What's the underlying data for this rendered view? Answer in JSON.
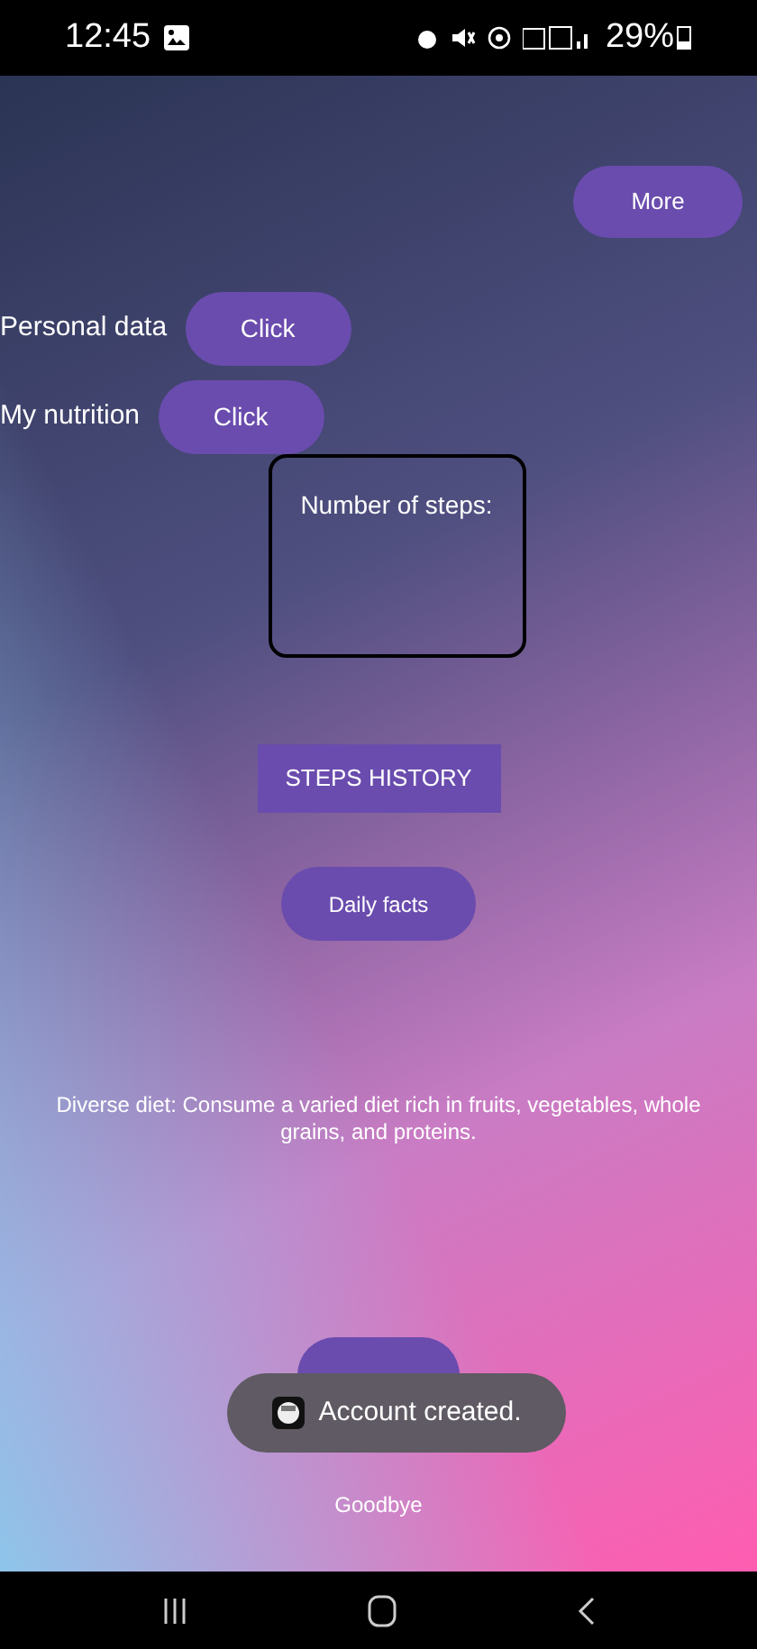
{
  "status_bar": {
    "time": "12:45",
    "battery": "29%"
  },
  "more_button": {
    "label": "More"
  },
  "rows": [
    {
      "label": "Personal data",
      "button": "Click"
    },
    {
      "label": "My nutrition",
      "button": "Click"
    }
  ],
  "steps_card": {
    "label": "Number of steps:"
  },
  "steps_history_button": {
    "label": "STEPS HISTORY"
  },
  "daily_facts_button": {
    "label": "Daily facts"
  },
  "fact": "Diverse diet: Consume a varied diet rich in fruits, vegetables, whole grains, and proteins.",
  "toast": {
    "message": "Account created."
  },
  "goodbye": "Goodbye"
}
